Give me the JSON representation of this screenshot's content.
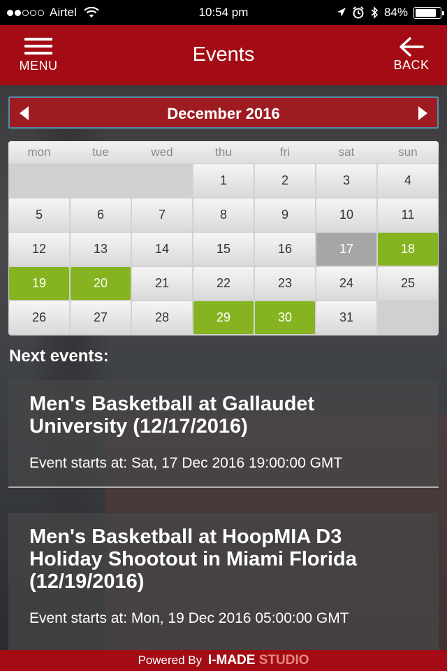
{
  "status_bar": {
    "carrier": "Airtel",
    "time": "10:54 pm",
    "battery": "84%",
    "battery_level": 0.84,
    "icons": [
      "signal-dots",
      "wifi-icon",
      "location-icon",
      "alarm-icon",
      "bluetooth-icon",
      "battery-icon"
    ]
  },
  "header": {
    "title": "Events",
    "menu_label": "MENU",
    "back_label": "BACK"
  },
  "calendar": {
    "month_label": "December 2016",
    "weekdays": [
      "mon",
      "tue",
      "wed",
      "thu",
      "fri",
      "sat",
      "sun"
    ],
    "days": [
      "1",
      "2",
      "3",
      "4",
      "5",
      "6",
      "7",
      "8",
      "9",
      "10",
      "11",
      "12",
      "13",
      "14",
      "15",
      "16",
      "17",
      "18",
      "19",
      "20",
      "21",
      "22",
      "23",
      "24",
      "25",
      "26",
      "27",
      "28",
      "29",
      "30",
      "31"
    ],
    "event_days": [
      18,
      19,
      20,
      29,
      30
    ],
    "today": 17,
    "colors": {
      "event": "#86b420",
      "today": "#a6a6a6"
    }
  },
  "next_events": {
    "heading": "Next events:",
    "items": [
      {
        "title": "Men's Basketball at Gallaudet University (12/17/2016)",
        "time": "Event starts at: Sat, 17 Dec 2016 19:00:00 GMT"
      },
      {
        "title": "Men's Basketball at HoopMIA D3 Holiday Shootout in Miami Florida (12/19/2016)",
        "time": "Event starts at: Mon, 19 Dec 2016 05:00:00 GMT"
      }
    ]
  },
  "footer": {
    "powered_by": "Powered By",
    "brand_a": "I-MADE",
    "brand_b": "STUDIO"
  },
  "theme": {
    "primary": "#a30c14",
    "month_bar": "#9e1b22"
  }
}
